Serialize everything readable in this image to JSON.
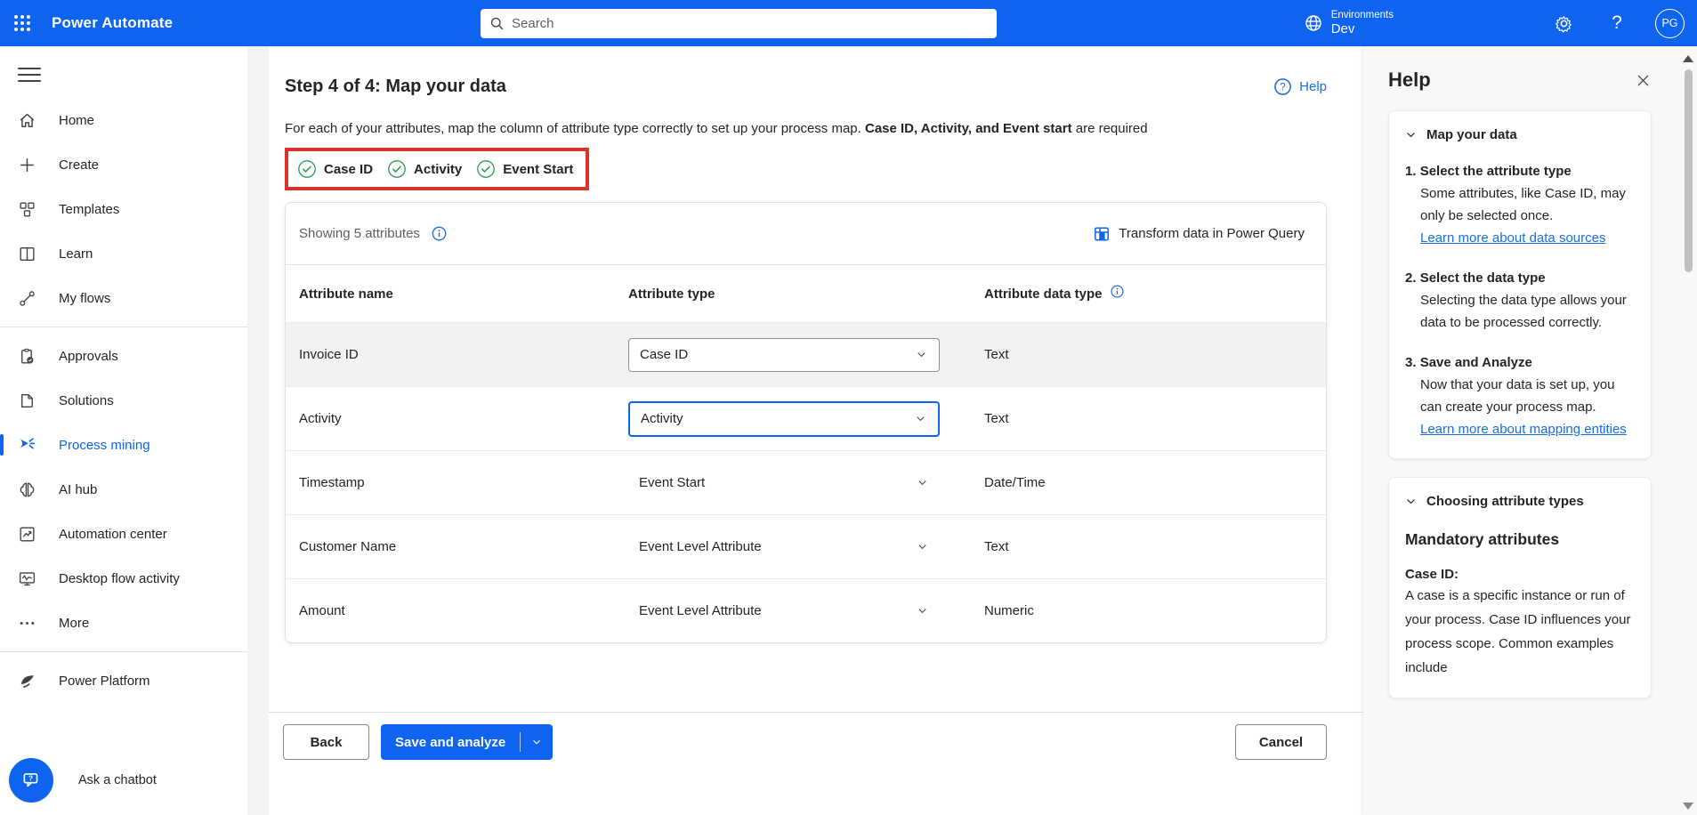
{
  "topbar": {
    "app_title": "Power Automate",
    "search_placeholder": "Search",
    "environments_label": "Environments",
    "environment_name": "Dev",
    "avatar_initials": "PG",
    "help_glyph": "?"
  },
  "sidebar": {
    "items": [
      {
        "label": "Home"
      },
      {
        "label": "Create"
      },
      {
        "label": "Templates"
      },
      {
        "label": "Learn"
      },
      {
        "label": "My flows"
      },
      {
        "label": "Approvals"
      },
      {
        "label": "Solutions"
      },
      {
        "label": "Process mining",
        "active": true
      },
      {
        "label": "AI hub"
      },
      {
        "label": "Automation center"
      },
      {
        "label": "Desktop flow activity"
      },
      {
        "label": "More"
      }
    ],
    "footer_item": "Power Platform",
    "chatbot_label": "Ask a chatbot"
  },
  "main": {
    "title": "Step 4 of 4: Map your data",
    "help_link_label": "Help",
    "description_prefix": "For each of your attributes, map the column of attribute type correctly to set up your process map. ",
    "description_bold": "Case ID, Activity, and Event start",
    "description_suffix": " are required",
    "required_badges": [
      "Case ID",
      "Activity",
      "Event Start"
    ],
    "table": {
      "showing_label": "Showing 5 attributes",
      "transform_label": "Transform data in Power Query",
      "columns": [
        "Attribute name",
        "Attribute type",
        "Attribute data type"
      ],
      "rows": [
        {
          "name": "Invoice ID",
          "type": "Case ID",
          "data_type": "Text"
        },
        {
          "name": "Activity",
          "type": "Activity",
          "data_type": "Text"
        },
        {
          "name": "Timestamp",
          "type": "Event Start",
          "data_type": "Date/Time"
        },
        {
          "name": "Customer Name",
          "type": "Event Level Attribute",
          "data_type": "Text"
        },
        {
          "name": "Amount",
          "type": "Event Level Attribute",
          "data_type": "Numeric"
        }
      ]
    },
    "footer": {
      "back_label": "Back",
      "save_label": "Save and analyze",
      "cancel_label": "Cancel"
    }
  },
  "help_panel": {
    "title": "Help",
    "section_map": {
      "title": "Map your data",
      "steps": [
        {
          "num": "1.",
          "title": "Select the attribute type",
          "body": "Some attributes, like Case ID, may only be selected once.",
          "link": "Learn more about data sources"
        },
        {
          "num": "2.",
          "title": "Select the data type",
          "body": "Selecting the data type allows your data to be processed correctly.",
          "link": ""
        },
        {
          "num": "3.",
          "title": "Save and Analyze",
          "body": "Now that your data is set up, you can create your process map.",
          "link": "Learn more about mapping entities"
        }
      ]
    },
    "section_attr": {
      "title": "Choosing attribute types",
      "heading": "Mandatory attributes",
      "term": "Case ID:",
      "body": "A case is a specific instance or run of your process. Case ID influences your process scope. Common examples include"
    }
  },
  "colors": {
    "header_blue": "#0E64EE",
    "primary_blue": "#0E64EE",
    "link_blue": "#1A6FE0",
    "success_green": "#2E9E57",
    "required_box_red": "#D7362D",
    "row_highlight": "#F3F2F1"
  }
}
